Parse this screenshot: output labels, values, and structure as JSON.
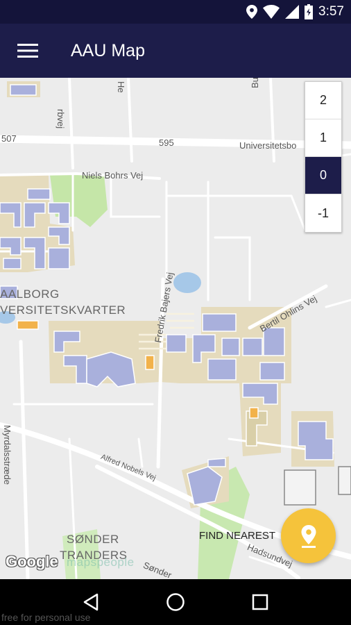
{
  "status_bar": {
    "time": "3:57",
    "icons": [
      "location-icon",
      "wifi-icon",
      "signal-icon",
      "battery-icon"
    ]
  },
  "app_bar": {
    "title": "AAU Map",
    "menu_icon": "hamburger-menu-icon"
  },
  "floor_picker": {
    "floors": [
      "2",
      "1",
      "0",
      "-1"
    ],
    "selected": "0"
  },
  "map": {
    "labels": {
      "road_507": "507",
      "road_595": "595",
      "universitetsbo": "Universitetsbo",
      "niels_bohrs_vej": "Niels Bohrs Vej",
      "aalborg": "AALBORG",
      "universitetskvarter": "VERSITETSKVARTER",
      "fredrik_bajers_vej": "Fredrik Bajers Vej",
      "bertil_ohlins_vej": "Bertil Ohlins Vej",
      "myrdalsstraede": "Myrdalsstræde",
      "alfred_nobels_vej": "Alfred Nobels Vej",
      "soender": "SØNDER",
      "tranders": "TRANDERS",
      "hadsundvej": "Hadsundvej",
      "soender_road": "Sønder",
      "budumvej": "Budumvej",
      "rbvej": "rbvej",
      "he": "He"
    },
    "colors": {
      "campus": "#e5dbbd",
      "building_fill": "#9aa4d8",
      "building_outline": "#ffffff",
      "park": "#bfe3a0",
      "water": "#a6c8e8",
      "road": "#ffffff"
    }
  },
  "find_nearest": {
    "label": "FIND NEAREST",
    "icon": "location-pin-icon",
    "color": "#f5c33b"
  },
  "attribution": {
    "google": "Google",
    "watermark": "mapspeople"
  },
  "nav_bar": {
    "icons": [
      "back-triangle-icon",
      "home-circle-icon",
      "recents-square-icon"
    ]
  },
  "footer": {
    "note": "free for personal use"
  }
}
